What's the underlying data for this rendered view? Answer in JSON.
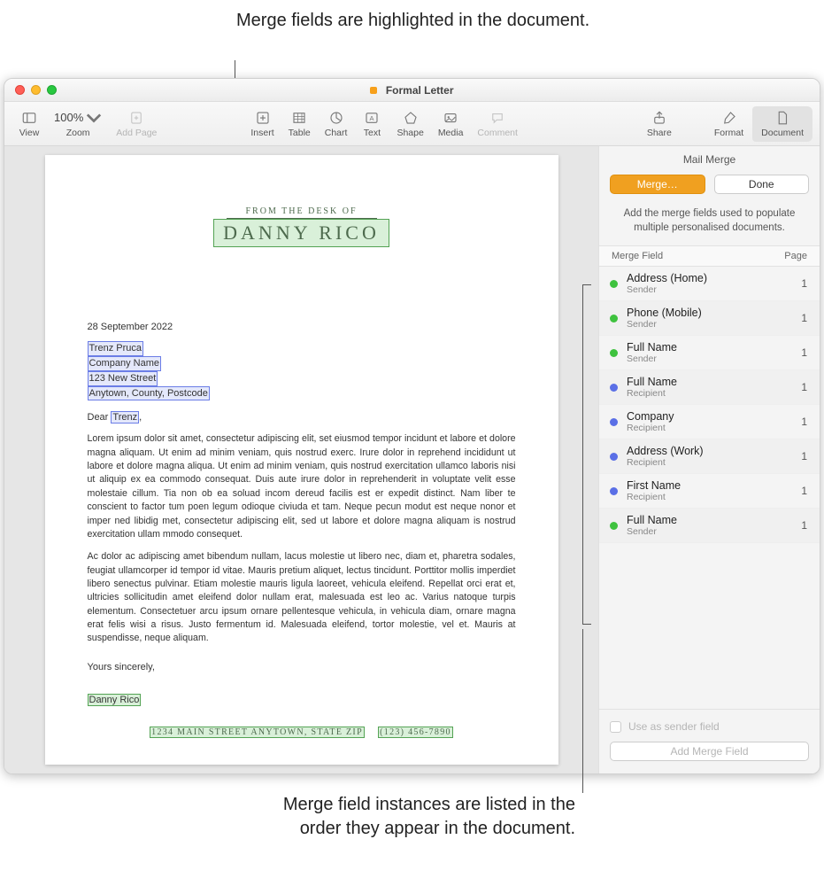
{
  "callouts": {
    "top": "Merge fields are highlighted in the document.",
    "bottom": "Merge field instances are listed in the order they appear in the document."
  },
  "window": {
    "title": "Formal Letter"
  },
  "toolbar": {
    "view": "View",
    "zoom": "Zoom",
    "zoom_value": "100%",
    "add_page": "Add Page",
    "insert": "Insert",
    "table": "Table",
    "chart": "Chart",
    "text": "Text",
    "shape": "Shape",
    "media": "Media",
    "comment": "Comment",
    "share": "Share",
    "format": "Format",
    "document": "Document"
  },
  "document": {
    "from_label": "FROM THE DESK OF",
    "sender_name": "DANNY RICO",
    "date": "28 September 2022",
    "recipient_name": "Trenz Pruca",
    "recipient_company": "Company Name",
    "recipient_street": "123 New Street",
    "recipient_city": "Anytown, County, Postcode",
    "salutation_prefix": "Dear ",
    "salutation_name": "Trenz",
    "salutation_suffix": ",",
    "para1": "Lorem ipsum dolor sit amet, consectetur adipiscing elit, set eiusmod tempor incidunt et labore et dolore magna aliquam. Ut enim ad minim veniam, quis nostrud exerc. Irure dolor in reprehend incididunt ut labore et dolore magna aliqua. Ut enim ad minim veniam, quis nostrud exercitation ullamco laboris nisi ut aliquip ex ea commodo consequat. Duis aute irure dolor in reprehenderit in voluptate velit esse molestaie cillum. Tia non ob ea soluad incom dereud facilis est er expedit distinct. Nam liber te conscient to factor tum poen legum odioque civiuda et tam. Neque pecun modut est neque nonor et imper ned libidig met, consectetur adipiscing elit, sed ut labore et dolore magna aliquam is nostrud exercitation ullam mmodo consequet.",
    "para2": "Ac dolor ac adipiscing amet bibendum nullam, lacus molestie ut libero nec, diam et, pharetra sodales, feugiat ullamcorper id tempor id vitae. Mauris pretium aliquet, lectus tincidunt. Porttitor mollis imperdiet libero senectus pulvinar. Etiam molestie mauris ligula laoreet, vehicula eleifend. Repellat orci erat et, ultricies sollicitudin amet eleifend dolor nullam erat, malesuada est leo ac. Varius natoque turpis elementum. Consectetuer arcu ipsum ornare pellentesque vehicula, in vehicula diam, ornare magna erat felis wisi a risus. Justo fermentum id. Malesuada eleifend, tortor molestie, vel et. Mauris at suspendisse, neque aliquam.",
    "signoff": "Yours sincerely,",
    "signature": "Danny Rico",
    "footer_address": "1234 MAIN STREET   ANYTOWN, STATE ZIP",
    "footer_phone": "(123) 456-7890"
  },
  "sidebar": {
    "title": "Mail Merge",
    "merge_btn": "Merge…",
    "done_btn": "Done",
    "desc": "Add the merge fields used to populate multiple personalised documents.",
    "col_field": "Merge Field",
    "col_page": "Page",
    "fields": [
      {
        "name": "Address (Home)",
        "sub": "Sender",
        "color": "g",
        "page": "1"
      },
      {
        "name": "Phone (Mobile)",
        "sub": "Sender",
        "color": "g",
        "page": "1"
      },
      {
        "name": "Full Name",
        "sub": "Sender",
        "color": "g",
        "page": "1"
      },
      {
        "name": "Full Name",
        "sub": "Recipient",
        "color": "b",
        "page": "1"
      },
      {
        "name": "Company",
        "sub": "Recipient",
        "color": "b",
        "page": "1"
      },
      {
        "name": "Address (Work)",
        "sub": "Recipient",
        "color": "b",
        "page": "1"
      },
      {
        "name": "First Name",
        "sub": "Recipient",
        "color": "b",
        "page": "1"
      },
      {
        "name": "Full Name",
        "sub": "Sender",
        "color": "g",
        "page": "1"
      }
    ],
    "use_as_sender": "Use as sender field",
    "add_field_btn": "Add Merge Field"
  }
}
